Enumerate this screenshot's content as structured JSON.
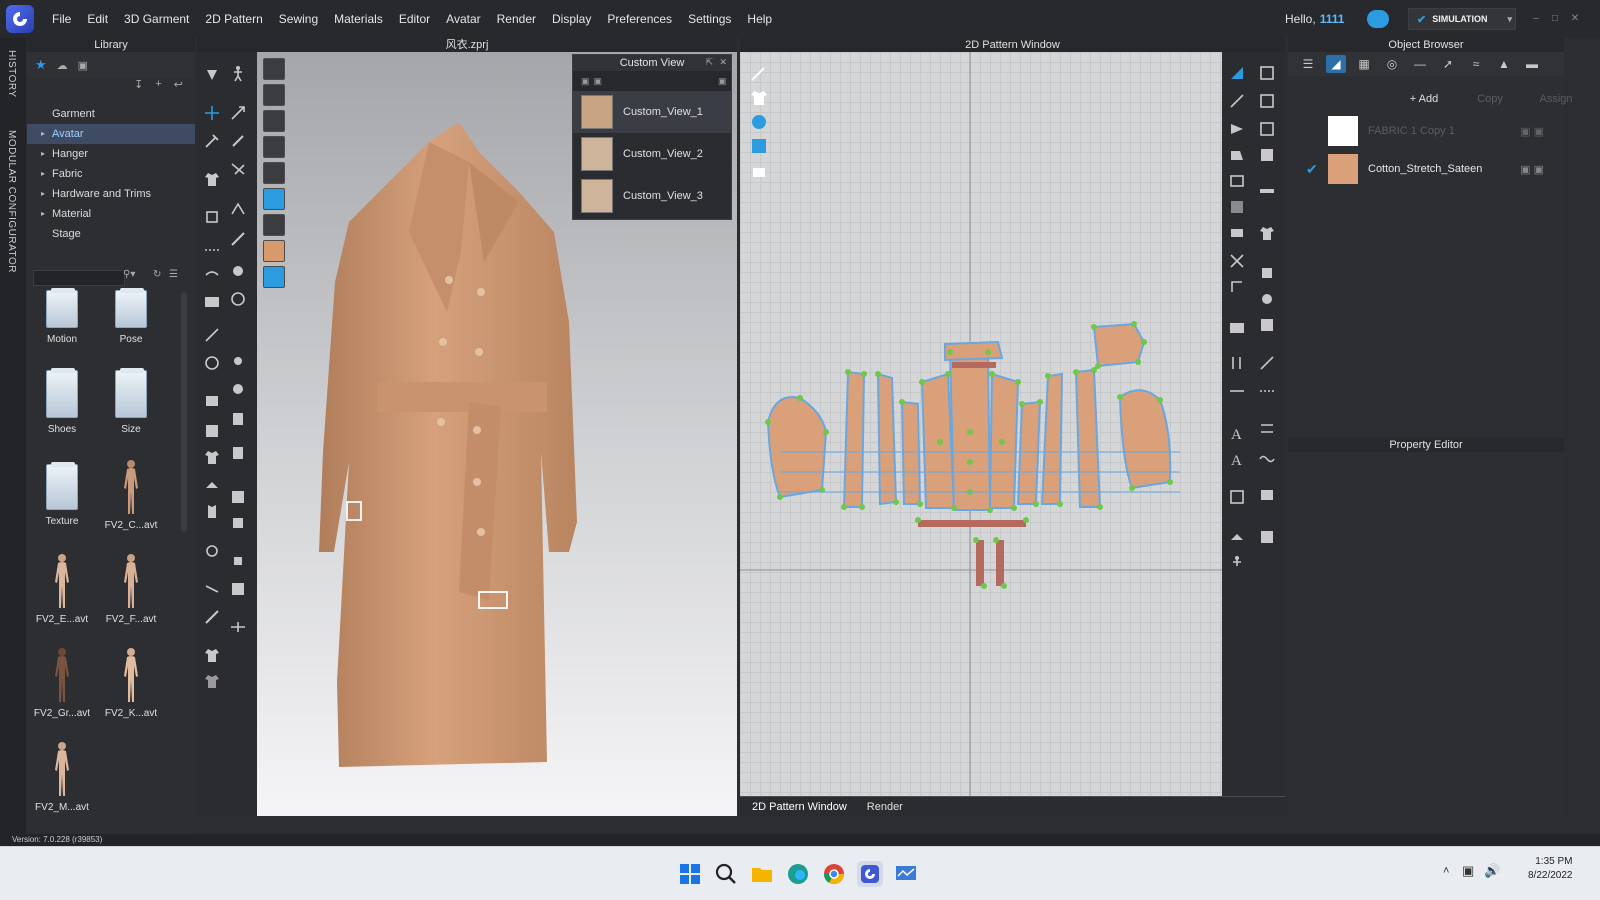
{
  "menubar": {
    "items": [
      "File",
      "Edit",
      "3D Garment",
      "2D Pattern",
      "Sewing",
      "Materials",
      "Editor",
      "Avatar",
      "Render",
      "Display",
      "Preferences",
      "Settings",
      "Help"
    ],
    "greeting": "Hello,",
    "username": "1111",
    "simulation_label": "SIMULATION"
  },
  "sidetabs": {
    "history": "HISTORY",
    "modular": "MODULAR CONFIGURATOR"
  },
  "library": {
    "title": "Library",
    "tree": [
      "Garment",
      "Avatar",
      "Hanger",
      "Fabric",
      "Hardware and Trims",
      "Material",
      "Stage"
    ],
    "selected": "Avatar",
    "grid": [
      "Motion",
      "Pose",
      "Shoes",
      "Size",
      "Texture",
      "FV2_C...avt",
      "FV2_E...avt",
      "FV2_F...avt",
      "FV2_Gr...avt",
      "FV2_K...avt",
      "FV2_M...avt"
    ]
  },
  "viewport3d": {
    "title": "风衣.zprj"
  },
  "custom_view": {
    "title": "Custom View",
    "items": [
      "Custom_View_1",
      "Custom_View_2",
      "Custom_View_3"
    ]
  },
  "pattern2d": {
    "title": "2D Pattern Window"
  },
  "bottom_tabs": [
    "2D Pattern Window",
    "Render"
  ],
  "object_browser": {
    "title": "Object Browser",
    "add": "+ Add",
    "copy": "Copy",
    "assign": "Assign",
    "fabrics": [
      {
        "name": "FABRIC 1 Copy 1",
        "color": "#ffffff"
      },
      {
        "name": "Cotton_Stretch_Sateen",
        "color": "#d9a07a"
      }
    ]
  },
  "property_editor": {
    "title": "Property Editor"
  },
  "status": {
    "version": "Version: 7.0.228 (r39853)"
  },
  "taskbar": {
    "time": "1:35 PM",
    "date": "8/22/2022"
  },
  "colors": {
    "accent": "#2d9be0",
    "selection": "#3e4b63",
    "fabric": "#d9a07a"
  }
}
